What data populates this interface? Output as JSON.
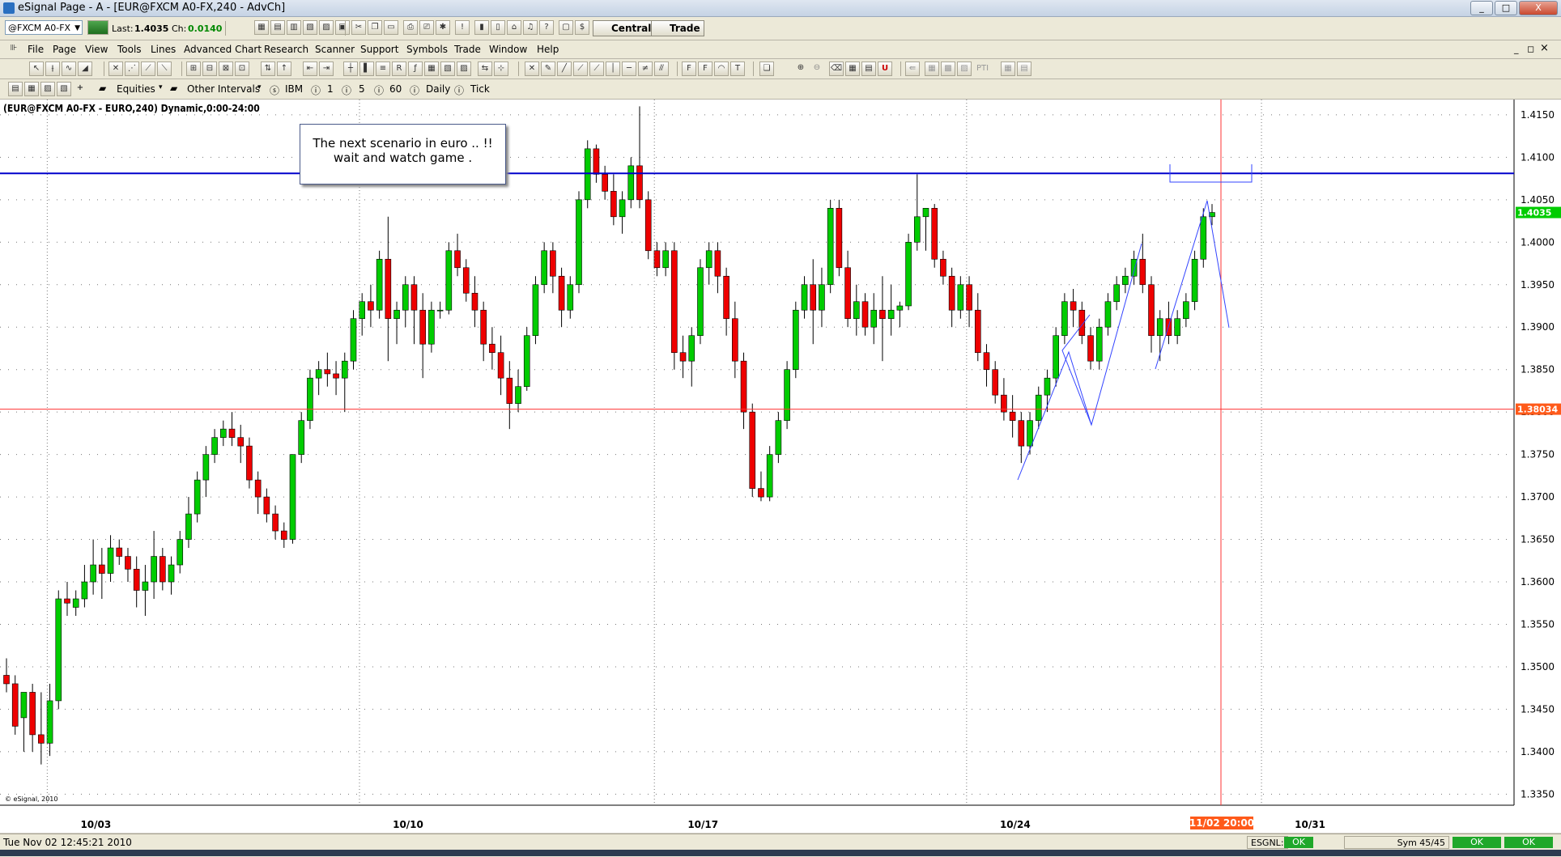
{
  "window": {
    "title": "eSignal Page - A - [EUR@FXCM A0-FX,240 - AdvCh]",
    "min": "_",
    "max": "□",
    "close": "X"
  },
  "quote_bar": {
    "symbol": "@FXCM A0-FX",
    "last_label": "Last:",
    "last": "1.4035",
    "ch_label": "Ch:",
    "change": "0.0140",
    "central": "Central",
    "trade": "Trade"
  },
  "menu": [
    "File",
    "Page",
    "View",
    "Tools",
    "Lines",
    "Advanced Chart",
    "Research",
    "Scanner",
    "Support",
    "Symbols",
    "Trade",
    "Window",
    "Help"
  ],
  "menu_ctrl": {
    "min": "_",
    "restore": "◻",
    "close": "×"
  },
  "toolbar3_text": {
    "ptl": "PTI"
  },
  "intervals": {
    "equities": "Equities",
    "other": "Other Intervals",
    "ibm": "IBM",
    "i1": "1",
    "i5": "5",
    "i60": "60",
    "daily": "Daily",
    "tick": "Tick"
  },
  "chart": {
    "label": "(EUR@FXCM A0-FX - EURO,240) Dynamic,0:00-24:00",
    "annotation": "The next scenario in euro .. !! wait and watch game .",
    "copyright": "© eSignal, 2010",
    "last_price_tag": "1.4035",
    "red_line_tag": "1.38034",
    "cursor_date_tag": "11/02 20:00",
    "colors": {
      "up": "#00cc00",
      "down": "#ee0000",
      "blue_line": "#0000cc",
      "red_line": "#ff3333",
      "pattern": "#3344ff"
    }
  },
  "chart_data": {
    "type": "candlestick",
    "title": "(EUR@FXCM A0-FX - EURO,240) Dynamic,0:00-24:00",
    "x_ticks": [
      "10/03",
      "10/10",
      "10/17",
      "10/24",
      "10/31"
    ],
    "y_ticks": [
      "1.4150",
      "1.4100",
      "1.4050",
      "1.4000",
      "1.3950",
      "1.3900",
      "1.3850",
      "1.3800",
      "1.3750",
      "1.3700",
      "1.3650",
      "1.3600",
      "1.3550",
      "1.3500",
      "1.3450",
      "1.3400",
      "1.3350"
    ],
    "ylim": [
      1.3337,
      1.4168
    ],
    "blue_resistance": 1.4081,
    "red_support": 1.38034,
    "last": 1.4035,
    "candles": [
      [
        1.349,
        1.351,
        1.347,
        1.348
      ],
      [
        1.348,
        1.349,
        1.342,
        1.343
      ],
      [
        1.344,
        1.347,
        1.34,
        1.347
      ],
      [
        1.347,
        1.348,
        1.34,
        1.342
      ],
      [
        1.342,
        1.347,
        1.3385,
        1.341
      ],
      [
        1.341,
        1.348,
        1.3395,
        1.346
      ],
      [
        1.346,
        1.359,
        1.345,
        1.358
      ],
      [
        1.358,
        1.36,
        1.356,
        1.3575
      ],
      [
        1.357,
        1.359,
        1.356,
        1.358
      ],
      [
        1.358,
        1.362,
        1.357,
        1.36
      ],
      [
        1.36,
        1.365,
        1.3585,
        1.362
      ],
      [
        1.362,
        1.364,
        1.358,
        1.361
      ],
      [
        1.361,
        1.3655,
        1.36,
        1.364
      ],
      [
        1.364,
        1.365,
        1.362,
        1.363
      ],
      [
        1.363,
        1.364,
        1.36,
        1.3615
      ],
      [
        1.3615,
        1.363,
        1.357,
        1.359
      ],
      [
        1.359,
        1.362,
        1.356,
        1.36
      ],
      [
        1.36,
        1.366,
        1.358,
        1.363
      ],
      [
        1.363,
        1.364,
        1.359,
        1.36
      ],
      [
        1.36,
        1.363,
        1.3585,
        1.362
      ],
      [
        1.362,
        1.366,
        1.361,
        1.365
      ],
      [
        1.365,
        1.37,
        1.364,
        1.368
      ],
      [
        1.368,
        1.373,
        1.367,
        1.372
      ],
      [
        1.372,
        1.376,
        1.37,
        1.375
      ],
      [
        1.375,
        1.378,
        1.374,
        1.377
      ],
      [
        1.377,
        1.379,
        1.376,
        1.378
      ],
      [
        1.378,
        1.38,
        1.376,
        1.377
      ],
      [
        1.377,
        1.3785,
        1.374,
        1.376
      ],
      [
        1.376,
        1.377,
        1.371,
        1.372
      ],
      [
        1.372,
        1.373,
        1.368,
        1.37
      ],
      [
        1.37,
        1.371,
        1.367,
        1.368
      ],
      [
        1.368,
        1.369,
        1.365,
        1.366
      ],
      [
        1.366,
        1.367,
        1.364,
        1.365
      ],
      [
        1.365,
        1.375,
        1.3645,
        1.375
      ],
      [
        1.375,
        1.38,
        1.374,
        1.379
      ],
      [
        1.379,
        1.385,
        1.378,
        1.384
      ],
      [
        1.384,
        1.386,
        1.382,
        1.385
      ],
      [
        1.385,
        1.387,
        1.383,
        1.3845
      ],
      [
        1.3845,
        1.386,
        1.382,
        1.384
      ],
      [
        1.384,
        1.387,
        1.38,
        1.386
      ],
      [
        1.386,
        1.392,
        1.385,
        1.391
      ],
      [
        1.391,
        1.394,
        1.389,
        1.393
      ],
      [
        1.393,
        1.395,
        1.39,
        1.392
      ],
      [
        1.392,
        1.399,
        1.391,
        1.398
      ],
      [
        1.398,
        1.403,
        1.386,
        1.391
      ],
      [
        1.391,
        1.393,
        1.388,
        1.392
      ],
      [
        1.392,
        1.396,
        1.39,
        1.395
      ],
      [
        1.395,
        1.396,
        1.388,
        1.392
      ],
      [
        1.392,
        1.394,
        1.384,
        1.388
      ],
      [
        1.388,
        1.393,
        1.387,
        1.392
      ],
      [
        1.392,
        1.393,
        1.391,
        1.392
      ],
      [
        1.392,
        1.4,
        1.3915,
        1.399
      ],
      [
        1.399,
        1.401,
        1.396,
        1.397
      ],
      [
        1.397,
        1.398,
        1.393,
        1.394
      ],
      [
        1.394,
        1.396,
        1.39,
        1.392
      ],
      [
        1.392,
        1.393,
        1.386,
        1.388
      ],
      [
        1.388,
        1.39,
        1.385,
        1.387
      ],
      [
        1.387,
        1.389,
        1.382,
        1.384
      ],
      [
        1.384,
        1.386,
        1.378,
        1.381
      ],
      [
        1.381,
        1.385,
        1.38,
        1.383
      ],
      [
        1.383,
        1.39,
        1.3825,
        1.389
      ],
      [
        1.389,
        1.396,
        1.388,
        1.395
      ],
      [
        1.395,
        1.4,
        1.394,
        1.399
      ],
      [
        1.399,
        1.4,
        1.394,
        1.396
      ],
      [
        1.396,
        1.397,
        1.39,
        1.392
      ],
      [
        1.392,
        1.396,
        1.391,
        1.395
      ],
      [
        1.395,
        1.406,
        1.394,
        1.405
      ],
      [
        1.405,
        1.412,
        1.404,
        1.411
      ],
      [
        1.411,
        1.4115,
        1.407,
        1.408
      ],
      [
        1.408,
        1.409,
        1.405,
        1.406
      ],
      [
        1.406,
        1.408,
        1.402,
        1.403
      ],
      [
        1.403,
        1.406,
        1.401,
        1.405
      ],
      [
        1.405,
        1.41,
        1.404,
        1.409
      ],
      [
        1.409,
        1.416,
        1.404,
        1.405
      ],
      [
        1.405,
        1.406,
        1.398,
        1.399
      ],
      [
        1.399,
        1.4,
        1.396,
        1.397
      ],
      [
        1.397,
        1.4,
        1.396,
        1.399
      ],
      [
        1.399,
        1.4,
        1.385,
        1.387
      ],
      [
        1.387,
        1.389,
        1.384,
        1.386
      ],
      [
        1.386,
        1.39,
        1.383,
        1.389
      ],
      [
        1.389,
        1.398,
        1.388,
        1.397
      ],
      [
        1.397,
        1.4,
        1.395,
        1.399
      ],
      [
        1.399,
        1.4,
        1.394,
        1.396
      ],
      [
        1.396,
        1.397,
        1.389,
        1.391
      ],
      [
        1.391,
        1.393,
        1.384,
        1.386
      ],
      [
        1.386,
        1.387,
        1.378,
        1.38
      ],
      [
        1.38,
        1.381,
        1.37,
        1.371
      ],
      [
        1.371,
        1.373,
        1.3695,
        1.37
      ],
      [
        1.37,
        1.376,
        1.3695,
        1.375
      ],
      [
        1.375,
        1.38,
        1.374,
        1.379
      ],
      [
        1.379,
        1.386,
        1.378,
        1.385
      ],
      [
        1.385,
        1.393,
        1.384,
        1.392
      ],
      [
        1.392,
        1.396,
        1.391,
        1.395
      ],
      [
        1.395,
        1.398,
        1.388,
        1.392
      ],
      [
        1.392,
        1.397,
        1.39,
        1.395
      ],
      [
        1.395,
        1.405,
        1.394,
        1.404
      ],
      [
        1.404,
        1.405,
        1.396,
        1.397
      ],
      [
        1.397,
        1.399,
        1.39,
        1.391
      ],
      [
        1.391,
        1.395,
        1.389,
        1.393
      ],
      [
        1.393,
        1.394,
        1.389,
        1.39
      ],
      [
        1.39,
        1.394,
        1.388,
        1.392
      ],
      [
        1.392,
        1.396,
        1.386,
        1.391
      ],
      [
        1.391,
        1.395,
        1.389,
        1.392
      ],
      [
        1.392,
        1.393,
        1.39,
        1.3925
      ],
      [
        1.3925,
        1.401,
        1.392,
        1.4
      ],
      [
        1.4,
        1.408,
        1.399,
        1.403
      ],
      [
        1.403,
        1.404,
        1.399,
        1.404
      ],
      [
        1.404,
        1.4045,
        1.397,
        1.398
      ],
      [
        1.398,
        1.399,
        1.395,
        1.396
      ],
      [
        1.396,
        1.397,
        1.39,
        1.392
      ],
      [
        1.392,
        1.396,
        1.391,
        1.395
      ],
      [
        1.395,
        1.396,
        1.39,
        1.392
      ],
      [
        1.392,
        1.394,
        1.386,
        1.387
      ],
      [
        1.387,
        1.388,
        1.383,
        1.385
      ],
      [
        1.385,
        1.386,
        1.381,
        1.382
      ],
      [
        1.382,
        1.384,
        1.379,
        1.38
      ],
      [
        1.38,
        1.382,
        1.377,
        1.379
      ],
      [
        1.379,
        1.38,
        1.374,
        1.376
      ],
      [
        1.376,
        1.38,
        1.375,
        1.379
      ],
      [
        1.379,
        1.383,
        1.378,
        1.382
      ],
      [
        1.382,
        1.385,
        1.38,
        1.384
      ],
      [
        1.384,
        1.39,
        1.383,
        1.389
      ],
      [
        1.389,
        1.394,
        1.388,
        1.393
      ],
      [
        1.393,
        1.3945,
        1.39,
        1.392
      ],
      [
        1.392,
        1.393,
        1.388,
        1.389
      ],
      [
        1.389,
        1.39,
        1.385,
        1.386
      ],
      [
        1.386,
        1.391,
        1.385,
        1.39
      ],
      [
        1.39,
        1.394,
        1.389,
        1.393
      ],
      [
        1.393,
        1.396,
        1.392,
        1.395
      ],
      [
        1.395,
        1.397,
        1.394,
        1.396
      ],
      [
        1.396,
        1.399,
        1.395,
        1.398
      ],
      [
        1.398,
        1.401,
        1.394,
        1.395
      ],
      [
        1.395,
        1.396,
        1.387,
        1.389
      ],
      [
        1.389,
        1.392,
        1.386,
        1.391
      ],
      [
        1.391,
        1.393,
        1.388,
        1.389
      ],
      [
        1.389,
        1.392,
        1.388,
        1.391
      ],
      [
        1.391,
        1.394,
        1.39,
        1.393
      ],
      [
        1.393,
        1.399,
        1.392,
        1.398
      ],
      [
        1.398,
        1.404,
        1.397,
        1.403
      ],
      [
        1.403,
        1.4045,
        1.402,
        1.4035
      ]
    ]
  },
  "status": {
    "time": "Tue Nov 02 12:45:21 2010",
    "esgnl": "ESGNL:",
    "ok": "OK",
    "sym": "Sym 45/45"
  }
}
